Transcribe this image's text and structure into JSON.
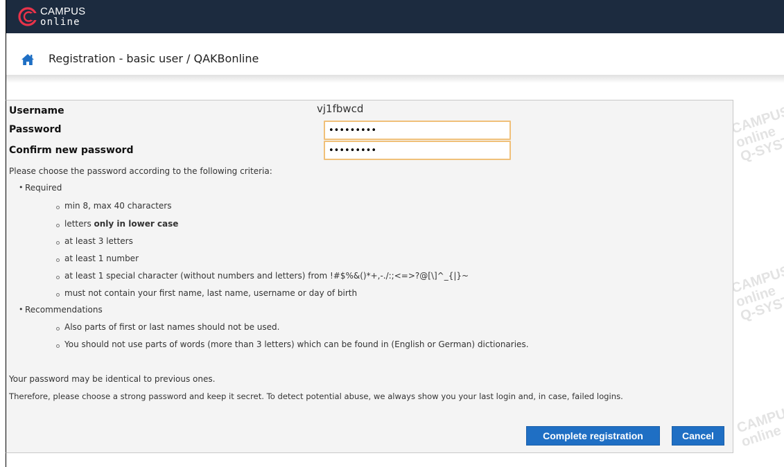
{
  "app": {
    "logo_top": "CAMPUS",
    "logo_bottom": "online"
  },
  "header": {
    "title": "Registration - basic user / QAKBonline"
  },
  "form": {
    "username_label": "Username",
    "username_value": "vj1fbwcd",
    "password_label": "Password",
    "password_value": "•••••••••",
    "confirm_label": "Confirm new password",
    "confirm_value": "•••••••••"
  },
  "criteria": {
    "intro": "Please choose the password according to the following criteria:",
    "required_label": "Required",
    "required_items": [
      "min 8, max 40 characters",
      "letters ",
      "at least 3 letters",
      "at least 1 number",
      "at least 1 special character (without numbers and letters) from !#$%&()*+,-./:;<=>?@[\\]^_{|}~",
      "must not contain your first name, last name, username or day of birth"
    ],
    "lowercase_emphasis": "only in lower case",
    "recommendations_label": "Recommendations",
    "recommendation_items": [
      "Also parts of first or last names should not be used.",
      "You should not use parts of words (more than 3 letters) which can be found in (English or German) dictionaries."
    ]
  },
  "notes": {
    "identical": "Your password may be identical to previous ones.",
    "therefore": "Therefore, please choose a strong password and keep it secret. To detect potential abuse, we always show you your last login and, in case, failed logins."
  },
  "buttons": {
    "complete": "Complete registration",
    "cancel": "Cancel"
  },
  "watermark": {
    "line1": "CAMPUS",
    "line2": "online",
    "line3": "Q-SYSTEM"
  },
  "colors": {
    "topbar": "#1c2b3f",
    "logo_accent": "#e8334a",
    "button": "#1f6fc4",
    "field_border": "#f0c079",
    "panel_bg": "#f4f4f4"
  }
}
